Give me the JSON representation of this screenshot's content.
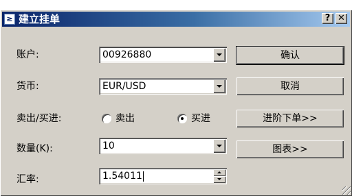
{
  "window": {
    "title": "建立挂单",
    "icon": "app-icon",
    "help_glyph": "?",
    "close_glyph": "✕"
  },
  "form": {
    "account": {
      "label": "账户:",
      "value": "00926880"
    },
    "symbol": {
      "label": "货币:",
      "value": "EUR/USD"
    },
    "direction": {
      "label": "卖出/买进:",
      "options": [
        {
          "label": "卖出",
          "checked": false
        },
        {
          "label": "买进",
          "checked": true
        }
      ]
    },
    "quantity": {
      "label": "数量(K):",
      "value": "10"
    },
    "rate": {
      "label": "汇率:",
      "value": "1.54011"
    }
  },
  "buttons": {
    "confirm": "确认",
    "cancel": "取消",
    "advanced": "进阶下单>>",
    "chart": "图表>>"
  },
  "colors": {
    "titlebar_start": "#0a246a",
    "titlebar_end": "#a6caf0",
    "dialog_bg": "#d4d0c8"
  }
}
